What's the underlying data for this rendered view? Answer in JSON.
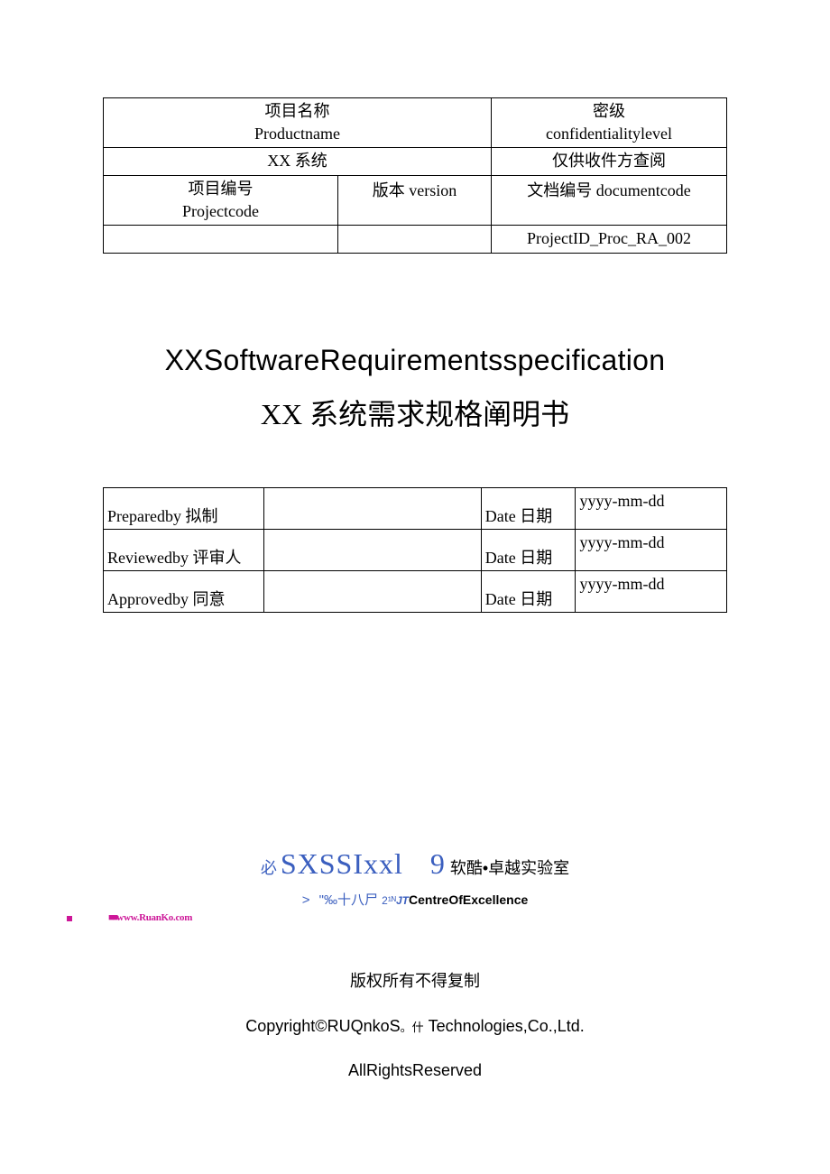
{
  "top_table": {
    "r1c1a": "项目名称",
    "r1c1b": "Productname",
    "r1c2a": "密级",
    "r1c2b": "confidentialitylevel",
    "r2c1": "XX 系统",
    "r2c2": "仅供收件方查阅",
    "r3c1a": "项目编号",
    "r3c1b": "Projectcode",
    "r3c2": "版本 version",
    "r3c3": "文档编号 documentcode",
    "r4c3": "ProjectID_Proc_RA_002"
  },
  "titles": {
    "en": "XXSoftwareRequirementsspecification",
    "zh": "XX 系统需求规格阐明书"
  },
  "sign": {
    "rows": [
      {
        "label": "Preparedby 拟制",
        "date_label": "Date 日期",
        "date_value": "yyyy-mm-dd"
      },
      {
        "label": "Reviewedby 评审人",
        "date_label": "Date 日期",
        "date_value": "yyyy-mm-dd"
      },
      {
        "label": "Approvedby 同意",
        "date_label": "Date 日期",
        "date_value": "yyyy-mm-dd"
      }
    ]
  },
  "logo": {
    "bi": "必",
    "sx": "SXSSIxxl",
    "nine": "9",
    "lab": "软酷•卓越实验室",
    "gt": ">",
    "fragment": "\"‰十八尸",
    "sup": "2¹ᴺ",
    "jt": "JT",
    "centre": "CentreOfExcellence",
    "dots": "■■",
    "url": "www.RuanKo.com"
  },
  "footer": {
    "zh": "版权所有不得复制",
    "copy_a": "Copyright©RUQnkoS",
    "copy_small": "。什",
    "copy_b": "Technologies,Co.,Ltd.",
    "rights": "AllRightsReserved"
  }
}
